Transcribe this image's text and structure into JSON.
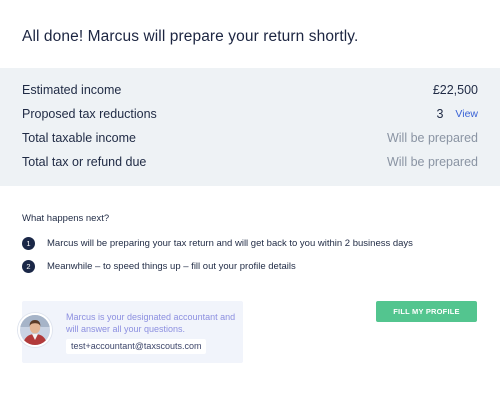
{
  "header": {
    "title": "All done! Marcus will prepare your return shortly."
  },
  "summary": {
    "rows": [
      {
        "label": "Estimated income",
        "value": "£22,500"
      },
      {
        "label": "Proposed tax reductions",
        "value": "3",
        "link": "View"
      },
      {
        "label": "Total taxable income",
        "value": "Will be prepared"
      },
      {
        "label": "Total tax or refund due",
        "value": "Will be prepared"
      }
    ]
  },
  "next_steps": {
    "title": "What happens next?",
    "steps": [
      {
        "number": "1",
        "text": "Marcus will be preparing your tax return and will get back to you within 2 business days"
      },
      {
        "number": "2",
        "text": "Meanwhile – to speed things up – fill out your profile details"
      }
    ]
  },
  "accountant": {
    "description": "Marcus is your designated accountant and will answer all your questions.",
    "email": "test+accountant@taxscouts.com"
  },
  "actions": {
    "fill_profile": "FILL MY PROFILE"
  },
  "colors": {
    "summary_bg": "#eef2f5",
    "navy": "#1a2747",
    "link_blue": "#3a63d6",
    "muted": "#8a94a3",
    "button_green": "#53c58f",
    "accountant_text": "#8c8fe0"
  }
}
